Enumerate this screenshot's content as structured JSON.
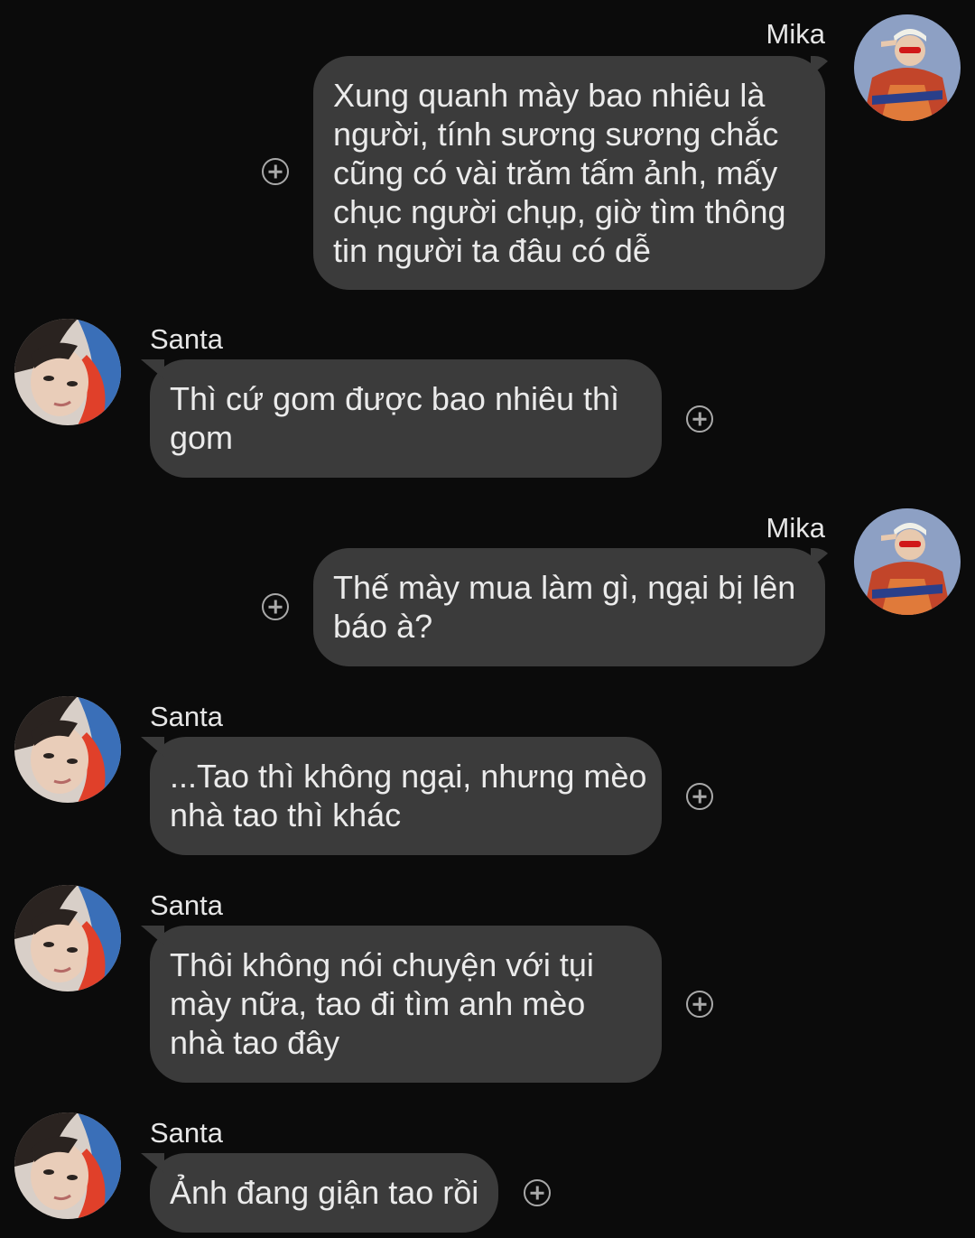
{
  "messages": [
    {
      "sender": "Mika",
      "lines": [
        "Xung quanh mày bao nhiêu là",
        "người, tính sương sương chắc",
        "cũng có vài trăm tấm ảnh, mấy",
        "chục người chụp, giờ tìm thông",
        "tin người ta đâu có dễ"
      ]
    },
    {
      "sender": "Santa",
      "lines": [
        "Thì cứ gom được bao nhiêu thì",
        "gom"
      ]
    },
    {
      "sender": "Mika",
      "lines": [
        "Thế mày mua làm gì, ngại bị lên",
        "báo à?"
      ]
    },
    {
      "sender": "Santa",
      "lines": [
        "...Tao thì không ngại, nhưng mèo",
        "nhà tao thì khác"
      ]
    },
    {
      "sender": "Santa",
      "lines": [
        "Thôi không nói chuyện với tụi",
        "mày nữa, tao đi tìm anh mèo",
        "nhà tao đây"
      ]
    },
    {
      "sender": "Santa",
      "lines": [
        "Ảnh đang giận tao rồi"
      ]
    }
  ],
  "colors": {
    "background": "#0b0b0b",
    "bubble": "#3b3b3b",
    "text": "#ebebeb",
    "icon": "#a9a9a9"
  },
  "icons": {
    "add_reaction": "plus-circle-icon",
    "avatar_mika": "avatar",
    "avatar_santa": "avatar"
  }
}
